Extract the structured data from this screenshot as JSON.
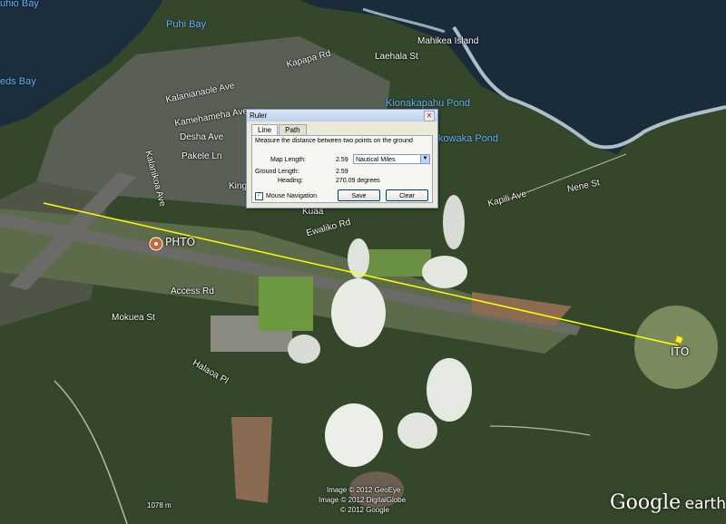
{
  "map_labels": {
    "kuhio_bay": "uhio Bay",
    "puhi_bay": "Puhi Bay",
    "reeds_bay": "eds Bay",
    "mahikea_island": "Mahikea Island",
    "laehala_st": "Laehala St",
    "kapapa_rd": "Kapapa Rd",
    "kalanianaole_ave": "Kalanianaole Ave",
    "kamehameha_ave": "Kamehameha Ave",
    "desha_ave": "Desha Ave",
    "pakele_ln": "Pakele Ln",
    "kalanikoa_ave": "Kalanikoa Ave",
    "king": "King",
    "kionakapahu_pond": "Kionakapahu Pond",
    "kauwaka_pond": "kowaka Pond",
    "nene_st": "Nene St",
    "kapili_ave": "Kapili Ave",
    "ewaliko_rd": "Ewaliko Rd",
    "kuaa": "Kuaa",
    "access_rd": "Access Rd",
    "mokuea_st": "Mokuea St",
    "haloa_pl": "Halaoa Pl",
    "phto": "PHTO",
    "ito": "ITO",
    "scale": "1078 m"
  },
  "attribution": {
    "line1": "Image © 2012 GeoEye",
    "line2": "Image © 2012 DigitalGlobe",
    "line3": "© 2012 Google"
  },
  "logo": {
    "google": "Google",
    "earth": "earth"
  },
  "ruler": {
    "title": "Ruler",
    "close": "✕",
    "tabs": [
      "Line",
      "Path"
    ],
    "description": "Measure the distance between two points on the ground",
    "map_length_label": "Map Length:",
    "map_length_value": "2.59",
    "unit": "Nautical Miles",
    "ground_length_label": "Ground Length:",
    "ground_length_value": "2.59",
    "heading_label": "Heading:",
    "heading_value": "270.09 degrees",
    "mouse_nav_label": "Mouse Navigation",
    "mouse_nav_checked": true,
    "save_label": "Save",
    "clear_label": "Clear"
  },
  "colors": {
    "ruler_line": "#ffff00",
    "water_label": "#66b3ff",
    "ocean": "#1a2b3a",
    "forest": "#35472a"
  }
}
